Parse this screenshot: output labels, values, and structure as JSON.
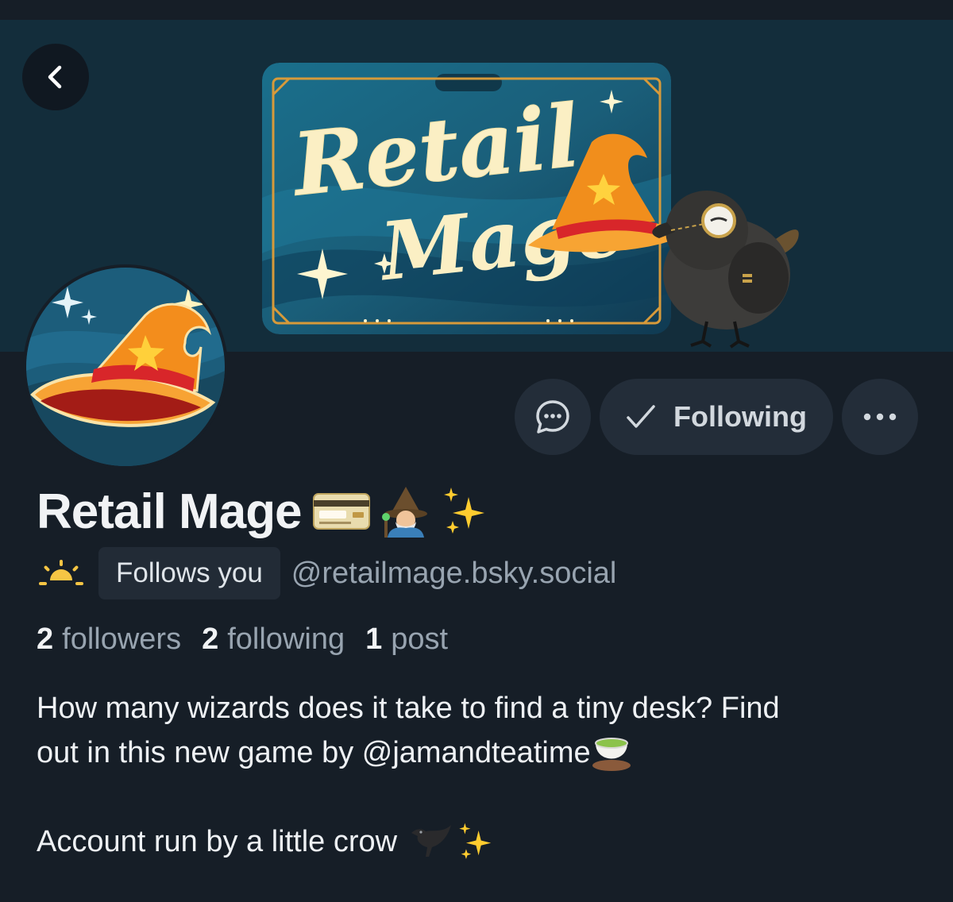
{
  "banner": {
    "logo_line1": "Retail",
    "logo_line2": "Mage"
  },
  "actions": {
    "following_label": "Following"
  },
  "profile": {
    "display_name": "Retail Mage",
    "follows_you_label": "Follows you",
    "handle": "@retailmage.bsky.social"
  },
  "stats": {
    "followers_count": "2",
    "followers_label": "followers",
    "following_count": "2",
    "following_label": "following",
    "posts_count": "1",
    "posts_label": "post"
  },
  "bio": {
    "line1": "How many wizards does it take to find a tiny desk? Find",
    "line2": "out in this new game by @jamandteatime",
    "line3": "Account run by a little crow"
  },
  "colors": {
    "background": "#161e27",
    "banner": "#132d3b",
    "button_bg": "#232d39",
    "text_primary": "#f1f3f5",
    "text_secondary": "#98a4b0"
  },
  "icons": {
    "back": "chevron-left-icon",
    "message": "chat-bubble-icon",
    "following_check": "checkmark-icon",
    "more": "ellipsis-icon",
    "moderation": "sunrise-icon"
  }
}
